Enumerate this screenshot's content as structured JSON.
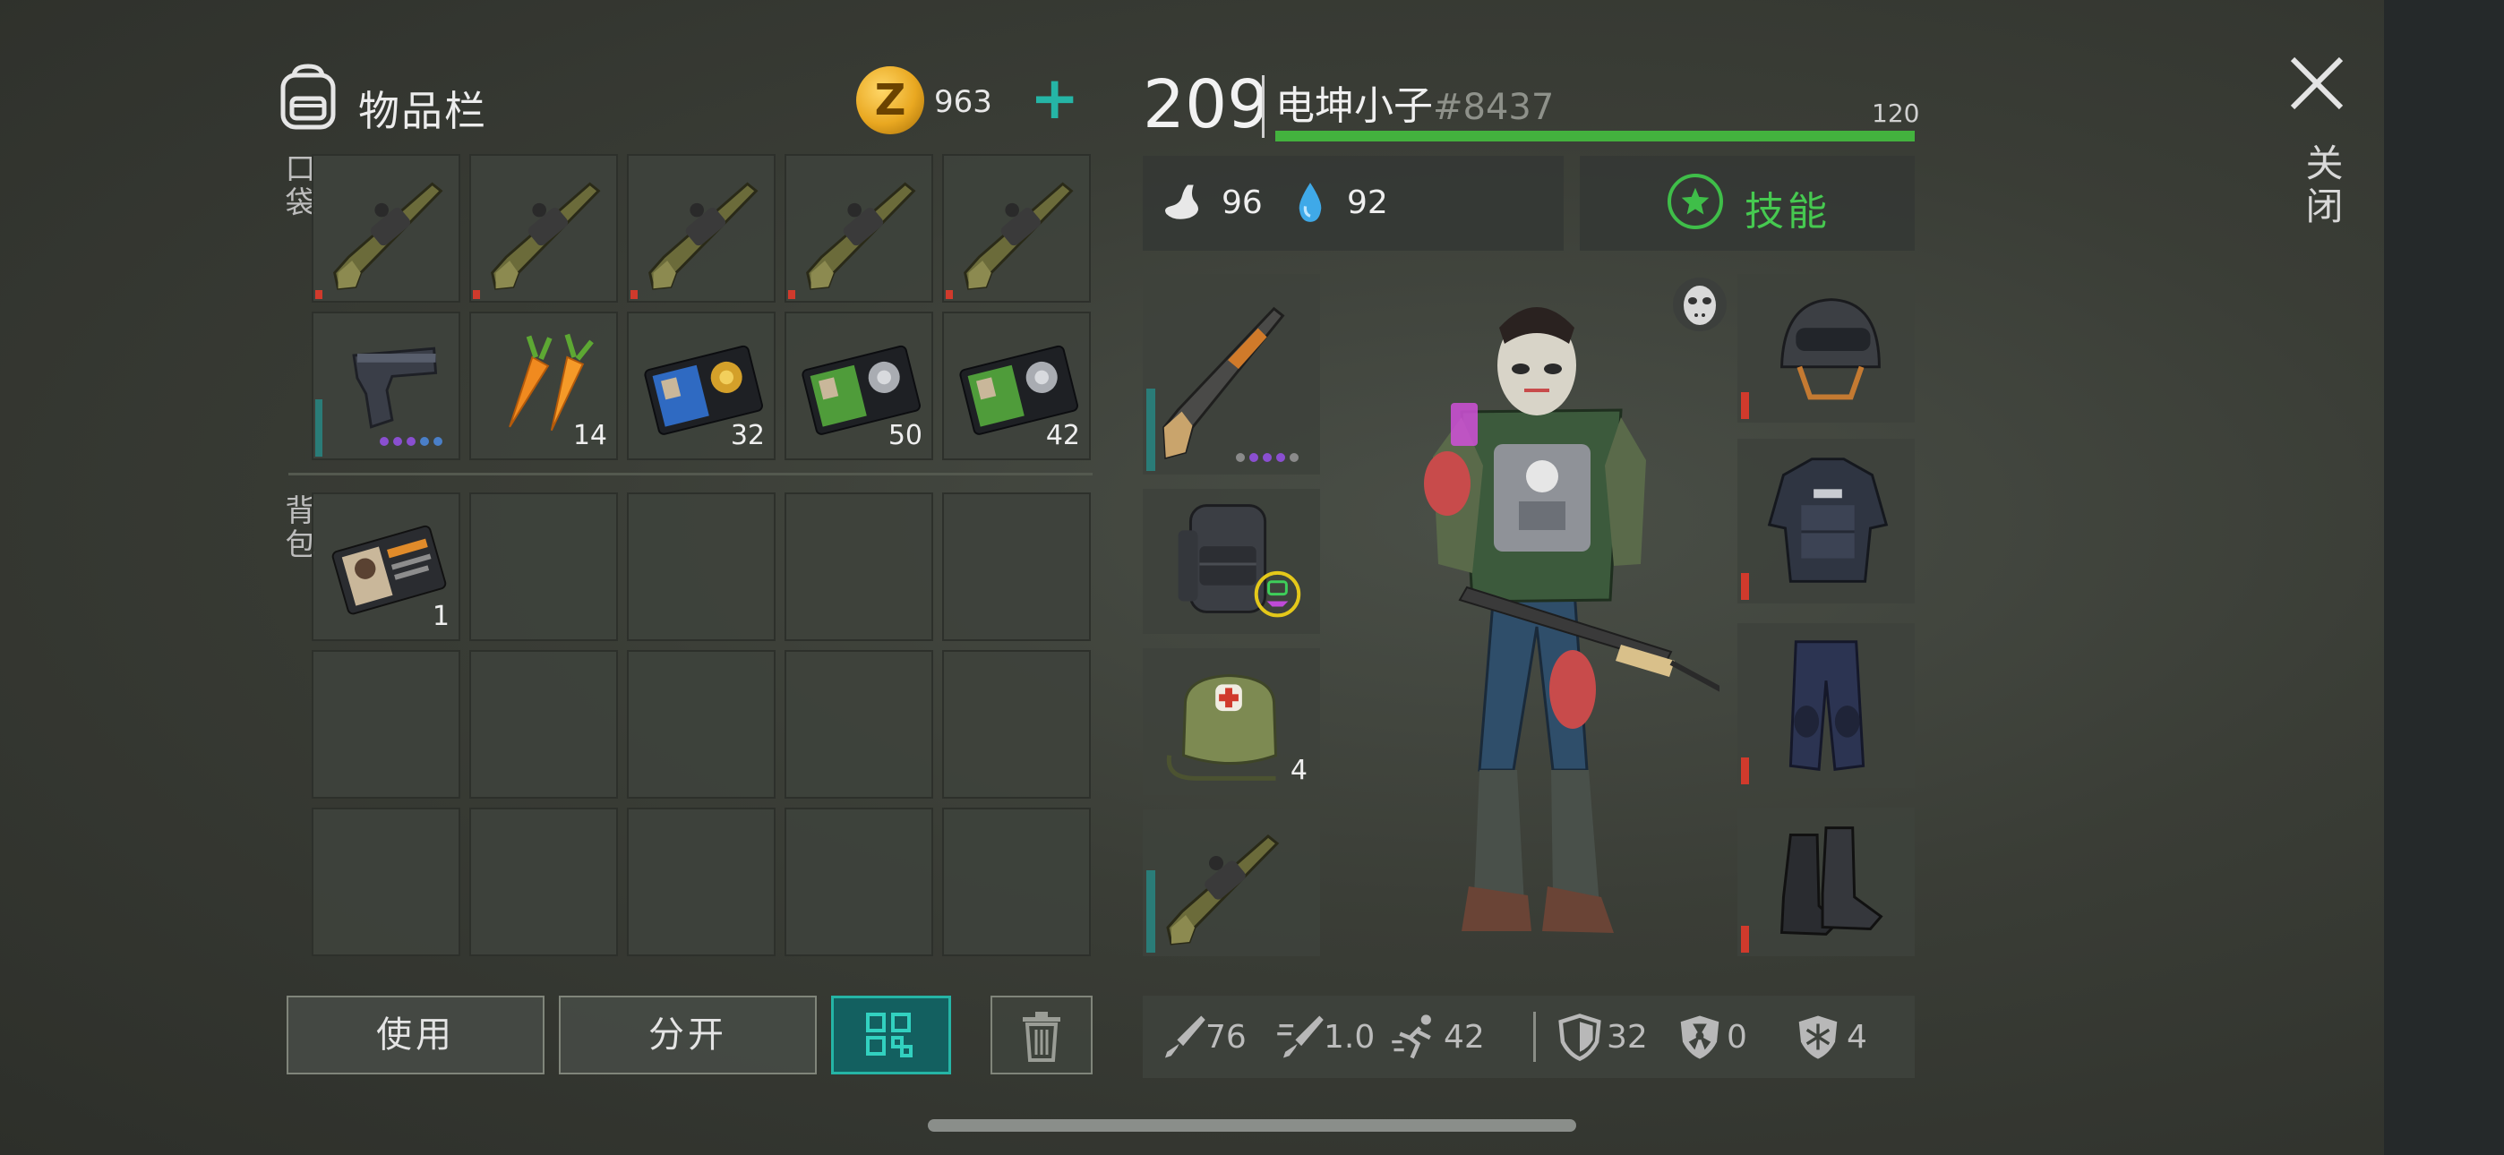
{
  "inventory": {
    "title": "物品栏",
    "pocket_label": "口袋",
    "backpack_label": "背包",
    "coins": "963",
    "pocket_slots": [
      {
        "item": "grenade-launcher",
        "count": ""
      },
      {
        "item": "grenade-launcher",
        "count": ""
      },
      {
        "item": "grenade-launcher",
        "count": ""
      },
      {
        "item": "grenade-launcher",
        "count": ""
      },
      {
        "item": "grenade-launcher",
        "count": ""
      },
      {
        "item": "pistol",
        "count": ""
      },
      {
        "item": "carrots",
        "count": "14"
      },
      {
        "item": "blue-police-badge",
        "count": "32"
      },
      {
        "item": "green-police-badge",
        "count": "50"
      },
      {
        "item": "green-police-badge",
        "count": "42"
      }
    ],
    "backpack_slots": [
      {
        "item": "patrol-officer-id",
        "count": "1"
      }
    ]
  },
  "buttons": {
    "use": "使用",
    "split": "分开"
  },
  "character": {
    "level": "209",
    "name": "电坤小子",
    "id": "#8437",
    "xp": "120",
    "hunger": "96",
    "thirst": "92",
    "skills_label": "技能",
    "weapon_slots": [
      {
        "item": "pump-shotgun",
        "count": ""
      },
      {
        "item": "tactical-backpack",
        "count": ""
      },
      {
        "item": "medkit-bag",
        "count": "4"
      },
      {
        "item": "grenade-launcher",
        "count": ""
      }
    ],
    "armor_slots": [
      "tactical-helmet",
      "police-vest",
      "tactical-pants",
      "combat-boots"
    ]
  },
  "stats": {
    "damage": "76",
    "attack_speed": "1.0",
    "move_speed": "42",
    "armor": "32",
    "radiation": "0",
    "cold": "4"
  },
  "close_label": "关闭",
  "colors": {
    "accent_teal": "#25b5a6",
    "xp_green": "#43b23e",
    "skill_green": "#46c950",
    "durability_red": "#d03a2c",
    "durability_teal": "#2a7c78",
    "coin_gold": "#e9a821"
  },
  "icons": {
    "inventory": "backpack-icon",
    "coin": "coin-icon",
    "add": "plus-icon",
    "hunger": "stomach-icon",
    "thirst": "water-drop-icon",
    "skills": "star-icon",
    "close": "close-icon",
    "grid": "grid-view-icon",
    "trash": "trash-icon",
    "mask": "hockey-mask-icon"
  }
}
